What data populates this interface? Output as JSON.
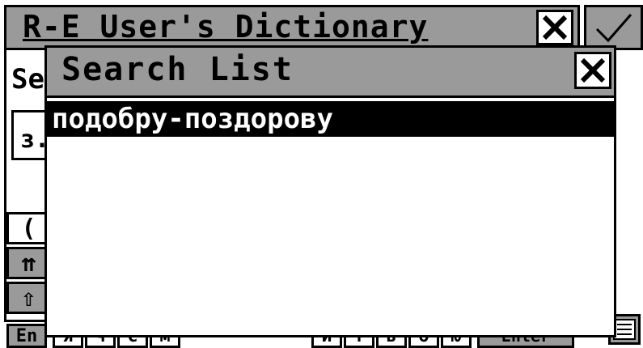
{
  "background_window": {
    "title": "R-E User's Dictionary",
    "label": "Se",
    "field_value": "з.",
    "keys": [
      "(",
      "⇈",
      "⇧",
      "En"
    ],
    "kb_row_keys": [
      "я",
      "ч",
      "с",
      "м",
      "и",
      "т",
      "ь",
      "б",
      "ю"
    ],
    "enter_key": "Enter"
  },
  "popup": {
    "title": "Search List",
    "items": [
      "подобру-поздорову"
    ],
    "selected_index": 0
  }
}
